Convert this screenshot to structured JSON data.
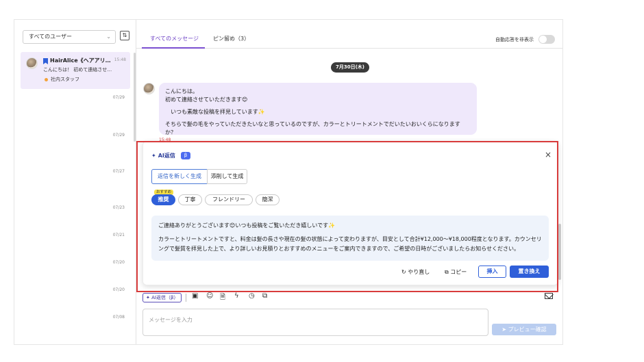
{
  "sidebar": {
    "user_filter": "すべてのユーザー",
    "conversation": {
      "name": "HairAlice《ヘアアリ…",
      "time": "15:48",
      "preview": "こんにちは！ 初めて連絡させ…",
      "tag": "社内スタッフ"
    },
    "dates": [
      "07/29",
      "07/29",
      "07/27",
      "07/23",
      "07/21",
      "07/20",
      "07/20",
      "07/08"
    ]
  },
  "tabs": [
    {
      "label": "すべてのメッセージ",
      "active": true
    },
    {
      "label": "ピン留め（3）",
      "active": false
    }
  ],
  "auto_reply": {
    "label": "自動応答を非表示",
    "enabled": false
  },
  "chat": {
    "date_divider": "7月30日(木)",
    "message": {
      "line1": "こんにちは。",
      "line2": "初めて連絡させていただきます😊",
      "line3": "いつも素敵な投稿を拝見しています✨",
      "line4": "そちらで髪の毛をやっていただきたいなと思っているのですが、カラーとトリートメントでだいたいおいくらになりますか？",
      "time": "15:48"
    }
  },
  "ai_panel": {
    "title": "AI返信",
    "beta": "β",
    "close": "×",
    "modes": [
      "返信を新しく生成",
      "添削して生成"
    ],
    "recommended_badge": "おすすめ",
    "tones": [
      "推奨",
      "丁寧",
      "フレンドリー",
      "簡潔"
    ],
    "result_line1": "ご連絡ありがとうございます😊いつも投稿をご覧いただき嬉しいです✨",
    "result_line2": "カラーとトリートメントですと、料金は髪の長さや現在の髪の状態によって変わりますが、目安として合計¥12,000〜¥18,000程度となります。カウンセリングで髪質を拝見した上で、より詳しいお見積りとおすすめのメニューをご案内できますので、ご希望の日時がございましたらお知らせください。",
    "redo_label": "やり直し",
    "copy_label": "コピー",
    "insert_label": "挿入",
    "replace_label": "置き換え"
  },
  "composer": {
    "ai_button": "AI返信（β）",
    "placeholder": "メッセージを入力",
    "preview_button": "プレビュー確認"
  }
}
